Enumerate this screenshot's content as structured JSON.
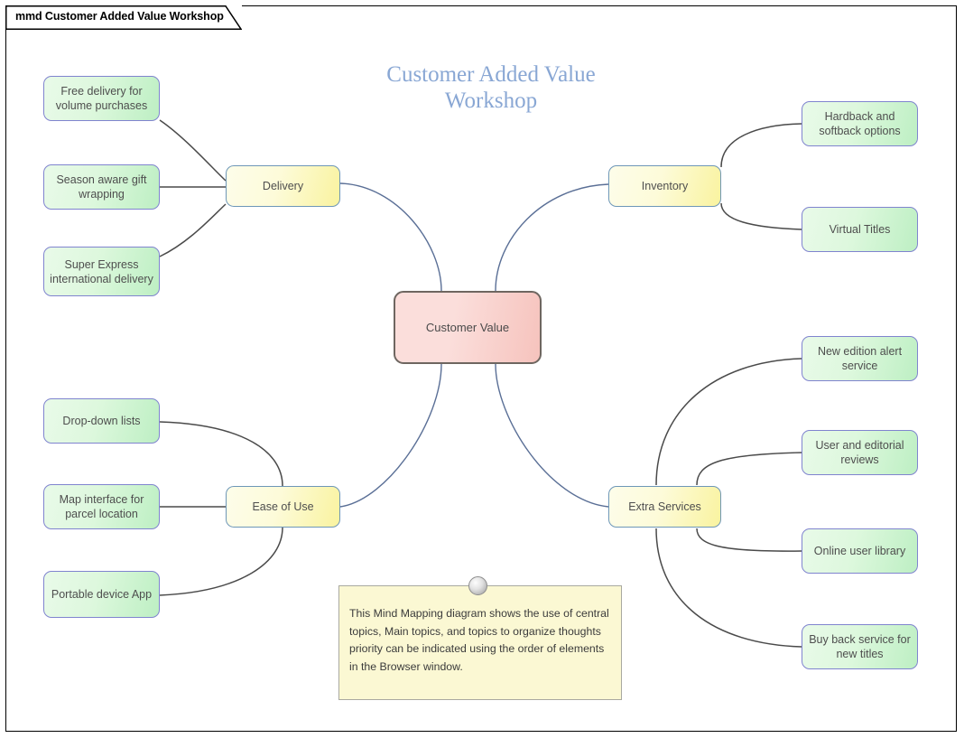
{
  "window": {
    "tab_label": "mmd Customer Added Value Workshop"
  },
  "diagram": {
    "title": "Customer Added Value Workshop",
    "title_color": "#89a7d4",
    "central_node_color": "#f6c3bd",
    "main_node_color": "#f9f39f",
    "leaf_node_color": "#bdefc3",
    "connector_color": "#4a4a4a",
    "center_connector_color": "#5a6f96"
  },
  "central": {
    "label": "Customer Value"
  },
  "branches": [
    {
      "id": "delivery",
      "label": "Delivery",
      "side": "left",
      "children": [
        {
          "label": "Free delivery for volume purchases"
        },
        {
          "label": "Season aware gift wrapping"
        },
        {
          "label": "Super Express international delivery"
        }
      ]
    },
    {
      "id": "ease-of-use",
      "label": "Ease of Use",
      "side": "left",
      "children": [
        {
          "label": "Drop-down lists"
        },
        {
          "label": "Map interface for parcel location"
        },
        {
          "label": "Portable device App"
        }
      ]
    },
    {
      "id": "inventory",
      "label": "Inventory",
      "side": "right",
      "children": [
        {
          "label": "Hardback and softback options"
        },
        {
          "label": "Virtual Titles"
        }
      ]
    },
    {
      "id": "extra-services",
      "label": "Extra Services",
      "side": "right",
      "children": [
        {
          "label": "New edition alert service"
        },
        {
          "label": "User and editorial reviews"
        },
        {
          "label": "Online user library"
        },
        {
          "label": "Buy back service for new titles"
        }
      ]
    }
  ],
  "note": {
    "text": "This Mind Mapping diagram shows the use of central topics, Main topics, and topics to organize thoughts priority can be indicated using the order of elements in the Browser window."
  }
}
